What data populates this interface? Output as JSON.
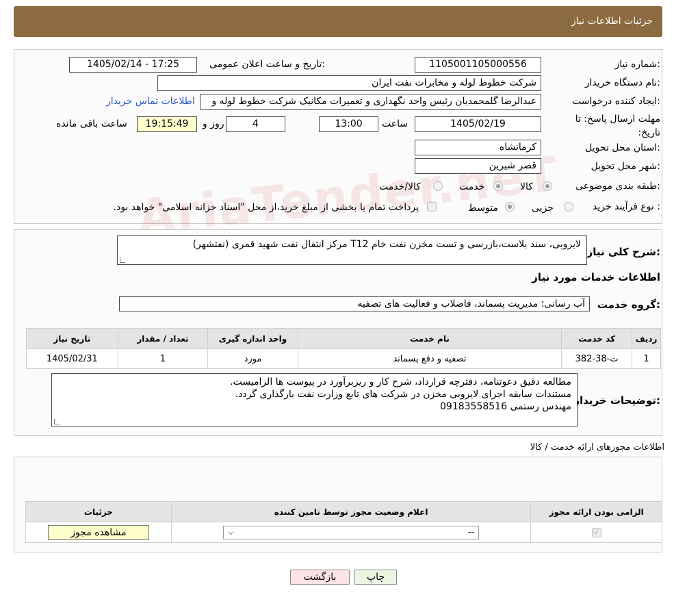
{
  "header": {
    "title": "جزئیات اطلاعات نیاز"
  },
  "info": {
    "need_number_label": "شماره نیاز:",
    "need_number": "1105001105000556",
    "announce_label": "تاریخ و ساعت اعلان عمومی:",
    "announce_value": "1405/02/14 - 17:25",
    "buyer_org_label": "نام دستگاه خریدار:",
    "buyer_org": "شرکت خطوط لوله و مخابرات نفت ایران",
    "creator_label": "ایجاد کننده درخواست:",
    "creator": "عبدالرضا گلمحمدیان رئیس واحد نگهداری و تعمیرات مکانیک  شرکت خطوط لوله و",
    "contact_link": "اطلاعات تماس خریدار",
    "deadline_label": "مهلت ارسال پاسخ: تا تاریخ:",
    "deadline_date": "1405/02/19",
    "time_label": "ساعت",
    "deadline_time": "13:00",
    "days_value": "4",
    "days_label": "روز و",
    "remaining_time": "19:15:49",
    "remaining_label": "ساعت باقی مانده",
    "province_label": "استان محل تحویل:",
    "province": "کرمانشاه",
    "city_label": "شهر محل تحویل:",
    "city": "قصر شیرین",
    "category_label": "طبقه بندی موضوعی:",
    "category_options": [
      "کالا",
      "خدمت",
      "کالا/خدمت"
    ],
    "process_label": "نوع فرآیند خرید :",
    "process_options": [
      "جزیی",
      "متوسط"
    ],
    "payment_note": "پرداخت تمام یا بخشی از مبلغ خرید،از محل \"اسناد خزانه اسلامی\" خواهد بود."
  },
  "watermark": "AriaTender.neT",
  "details": {
    "summary_label": "شرح کلی نیاز:",
    "summary": "لایروبی، سند بلاست،بازرسی و تست مخزن نفت خام T12 مرکز انتقال نفت شهید قمری (نفتشهر)",
    "services_title": "اطلاعات خدمات مورد نیاز",
    "service_group_label": "گروه خدمت:",
    "service_group": "آب رسانی؛ مدیریت پسماند، فاضلاب و فعالیت های تصفیه",
    "table": {
      "headers": [
        "ردیف",
        "کد خدمت",
        "نام خدمت",
        "واحد اندازه گیری",
        "تعداد / مقدار",
        "تاریخ نیاز"
      ],
      "rows": [
        [
          "1",
          "ث-38-382",
          "تصفیه و دفع پسماند",
          "مورد",
          "1",
          "1405/02/31"
        ]
      ]
    },
    "buyer_notes_label": "توضیحات خریدار:",
    "buyer_notes": [
      "مطالعه دقیق دعوتنامه، دفترچه قرارداد، شرح کار و ریزبرآورد در پیوست ها الزامیست.",
      "مستندات سابقه اجرای لایروبی مخزن در شرکت های تابع وزارت نفت بارگذاری گردد.",
      "مهندس رستمی 09183558516"
    ]
  },
  "licenses": {
    "title": "اطلاعات مجوزهای ارائه خدمت / کالا",
    "headers": [
      "الزامی بودن ارائه مجوز",
      "اعلام وضعیت مجوز توسط تامین کننده",
      "جزئیات"
    ],
    "select_value": "--",
    "view_button": "مشاهده مجوز"
  },
  "footer": {
    "print_button": "چاپ",
    "back_button": "بازگشت"
  }
}
